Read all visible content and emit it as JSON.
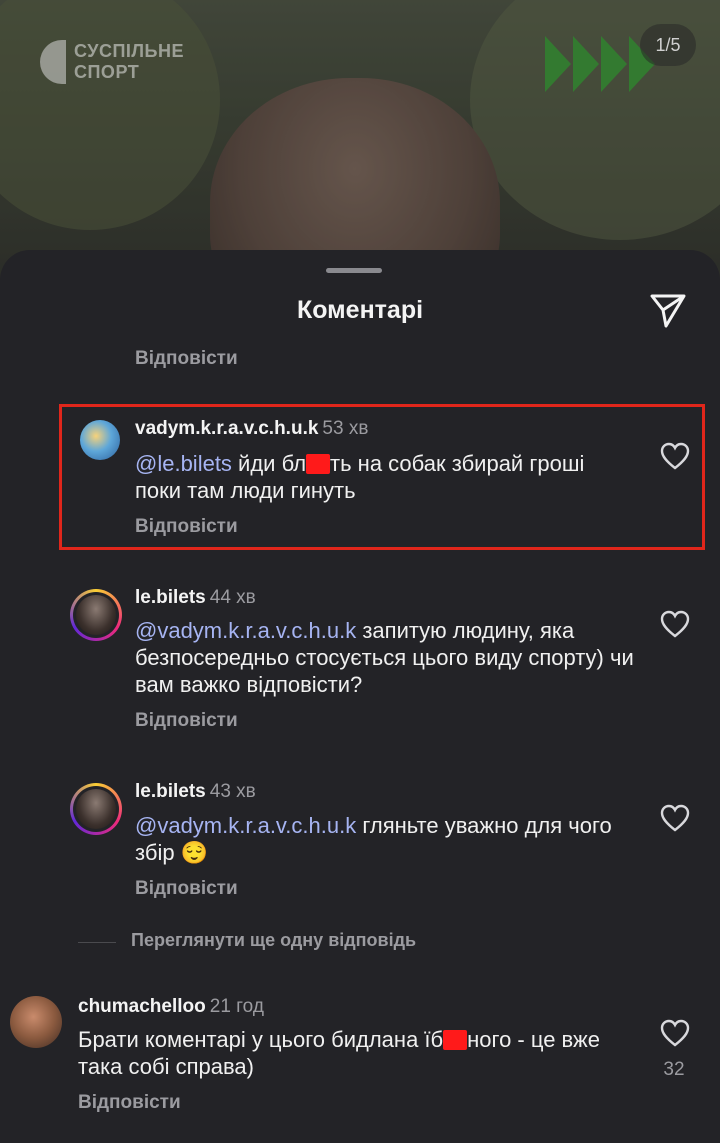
{
  "media": {
    "brand_line1": "СУСПІЛЬНЕ",
    "brand_line2": "СПОРТ",
    "counter": "1/5"
  },
  "sheet": {
    "title": "Коментарі",
    "share_icon": "paper-plane-icon"
  },
  "reply_label": "Відповісти",
  "comments": [
    {
      "username": "vadym.k.r.a.v.c.h.u.k",
      "time": "53 хв",
      "mention": "@le.bilets",
      "text_a": " йди бл",
      "text_b": "ть на собак збирай гроші поки там люди гинуть",
      "highlighted": true
    },
    {
      "username": "le.bilets",
      "time": "44 хв",
      "mention": "@vadym.k.r.a.v.c.h.u.k",
      "text": " запитую людину, яка безпосередньо стосується цього виду спорту) чи вам важко відповісти?"
    },
    {
      "username": "le.bilets",
      "time": "43 хв",
      "mention": "@vadym.k.r.a.v.c.h.u.k",
      "text": " гляньте  уважно для чого збір 😌"
    },
    {
      "username": "chumachelloo",
      "time": "21 год",
      "text_a": "Брати коментарі у цього бидлана їб",
      "text_b": "ного - це вже така собі справа)",
      "likes": "32"
    }
  ],
  "more_replies": "Переглянути ще одну відповідь",
  "colors": {
    "sheet_bg": "#232327",
    "mention": "#a6b4f2",
    "highlight_border": "#e0261b",
    "secondary_text": "#9b9ba0"
  }
}
